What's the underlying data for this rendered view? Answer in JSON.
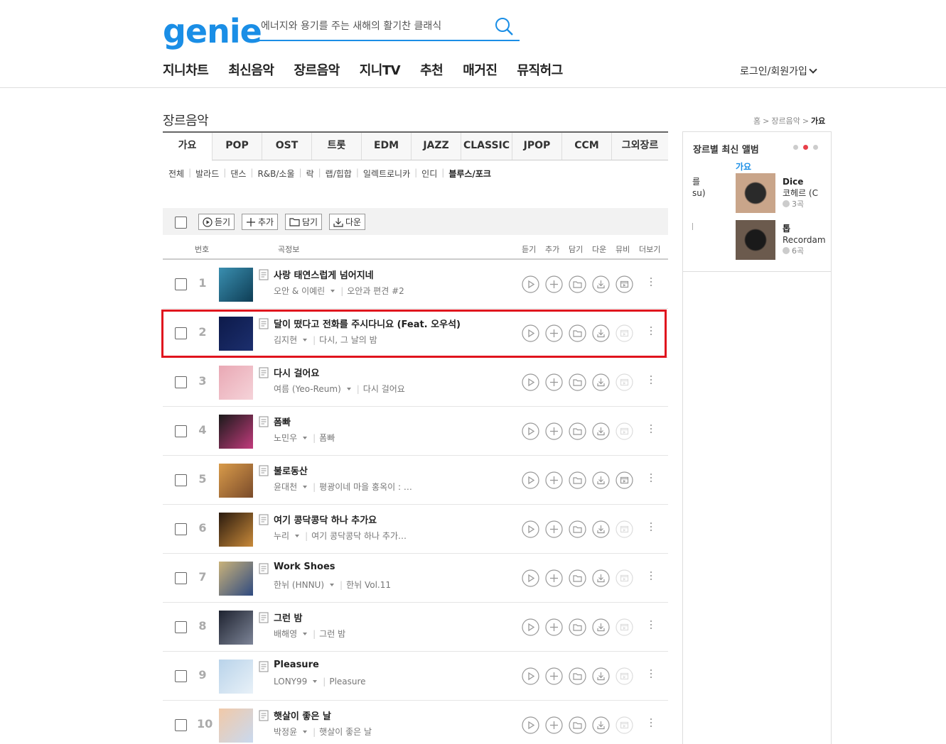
{
  "header": {
    "logo": "genie",
    "search_placeholder": "에너지와 용기를 주는 새해의 활기찬 클래식",
    "nav": [
      "지니차트",
      "최신음악",
      "장르음악",
      "지니TV",
      "추천",
      "매거진",
      "뮤직허그"
    ],
    "login": "로그인/회원가입"
  },
  "page": {
    "title": "장르음악",
    "breadcrumb": [
      "홈",
      "장르음악",
      "가요"
    ]
  },
  "genre_tabs": [
    "가요",
    "POP",
    "OST",
    "트롯",
    "EDM",
    "JAZZ",
    "CLASSIC",
    "JPOP",
    "CCM",
    "그외장르"
  ],
  "active_genre_tab": "가요",
  "sub_genres": [
    "전체",
    "발라드",
    "댄스",
    "R&B/소울",
    "락",
    "랩/힙합",
    "일렉트로니카",
    "인디",
    "블루스/포크"
  ],
  "active_sub_genre": "블루스/포크",
  "toolbar": {
    "listen": "듣기",
    "add": "추가",
    "save": "담기",
    "download": "다운"
  },
  "table_header": {
    "number": "번호",
    "song_info": "곡정보",
    "listen": "듣기",
    "add": "추가",
    "save": "담기",
    "download": "다운",
    "mv": "뮤비",
    "more": "더보기"
  },
  "songs": [
    {
      "rank": "1",
      "title": "사랑 태연스럽게 넘어지네",
      "artist": "오안 & 이예린",
      "album": "오안과 편견 #2",
      "mv": true,
      "colors": [
        "#3a8fb0",
        "#0e3d55"
      ]
    },
    {
      "rank": "2",
      "title": "달이 떴다고 전화를 주시다니요 (Feat. 오우석)",
      "artist": "김지현",
      "album": "다시, 그 날의 밤",
      "mv": false,
      "colors": [
        "#0d1a4a",
        "#1c2f6e"
      ]
    },
    {
      "rank": "3",
      "title": "다시 걸어요",
      "artist": "여름 (Yeo-Reum)",
      "album": "다시 걸어요",
      "mv": false,
      "colors": [
        "#e9a8b4",
        "#f5d3d9"
      ]
    },
    {
      "rank": "4",
      "title": "폼빠",
      "artist": "노민우",
      "album": "폼빠",
      "mv": false,
      "colors": [
        "#1a1a1a",
        "#c23b7c"
      ]
    },
    {
      "rank": "5",
      "title": "불로동산",
      "artist": "윤대천",
      "album": "평광이네 마을 홍옥이 : …",
      "mv": true,
      "colors": [
        "#d99b4a",
        "#7a4b2a"
      ]
    },
    {
      "rank": "6",
      "title": "여기 콩닥콩닥 하나 추가요",
      "artist": "누리",
      "album": "여기 콩닥콩닥 하나 추가…",
      "mv": false,
      "colors": [
        "#2a1a0e",
        "#c98a3a"
      ]
    },
    {
      "rank": "7",
      "title": "Work Shoes",
      "artist": "한뉘 (HNNU)",
      "album": "한뉘 Vol.11",
      "mv": false,
      "colors": [
        "#c9b27a",
        "#2f4a80"
      ]
    },
    {
      "rank": "8",
      "title": "그런 밤",
      "artist": "배해영",
      "album": "그런 밤",
      "mv": false,
      "colors": [
        "#1e2330",
        "#7d8497"
      ]
    },
    {
      "rank": "9",
      "title": "Pleasure",
      "artist": "LONY99",
      "album": "Pleasure",
      "mv": false,
      "colors": [
        "#b9d3ea",
        "#e8f1f8"
      ]
    },
    {
      "rank": "10",
      "title": "햇살이 좋은 날",
      "artist": "박정윤",
      "album": "햇살이 좋은 날",
      "mv": false,
      "colors": [
        "#f1c9a8",
        "#c9d9ef"
      ]
    }
  ],
  "side_panel": {
    "title": "장르별 최신 앨범",
    "category": "가요",
    "cut_text_1": "를",
    "cut_text_2": "su)",
    "albums": [
      {
        "name": "Dice",
        "artist": "코헤르 (C",
        "count": "3곡",
        "colors": [
          "#c9a58a",
          "#2a2a2a"
        ]
      },
      {
        "name": "톱",
        "artist": "Recordam",
        "count": "6곡",
        "colors": [
          "#6b5a4d",
          "#1a1a1a"
        ]
      }
    ]
  },
  "colors": {
    "brand": "#1a8ee6",
    "highlight": "#e0141e",
    "dot_active": "#e8404a"
  }
}
